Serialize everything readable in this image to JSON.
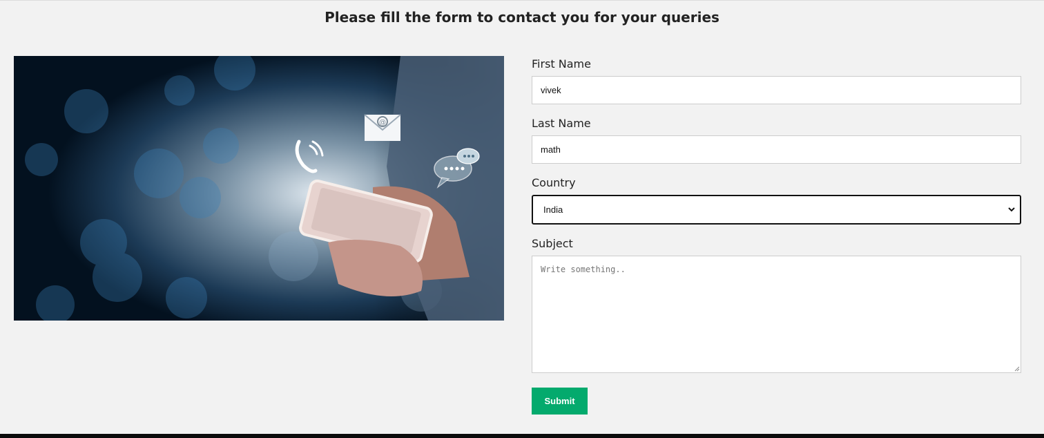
{
  "page": {
    "heading": "Please fill the form to contact you for your queries"
  },
  "hero": {
    "description_icons": [
      "phone-icon",
      "email-icon",
      "chat-bubble-icon"
    ]
  },
  "form": {
    "first_name": {
      "label": "First Name",
      "value": "vivek"
    },
    "last_name": {
      "label": "Last Name",
      "value": "math"
    },
    "country": {
      "label": "Country",
      "selected": "India"
    },
    "subject": {
      "label": "Subject",
      "placeholder": "Write something.."
    },
    "submit_label": "Submit"
  },
  "colors": {
    "background": "#f2f2f2",
    "submit_button": "#04aa6d",
    "input_border": "#cccccc",
    "focus_border": "#111111"
  }
}
